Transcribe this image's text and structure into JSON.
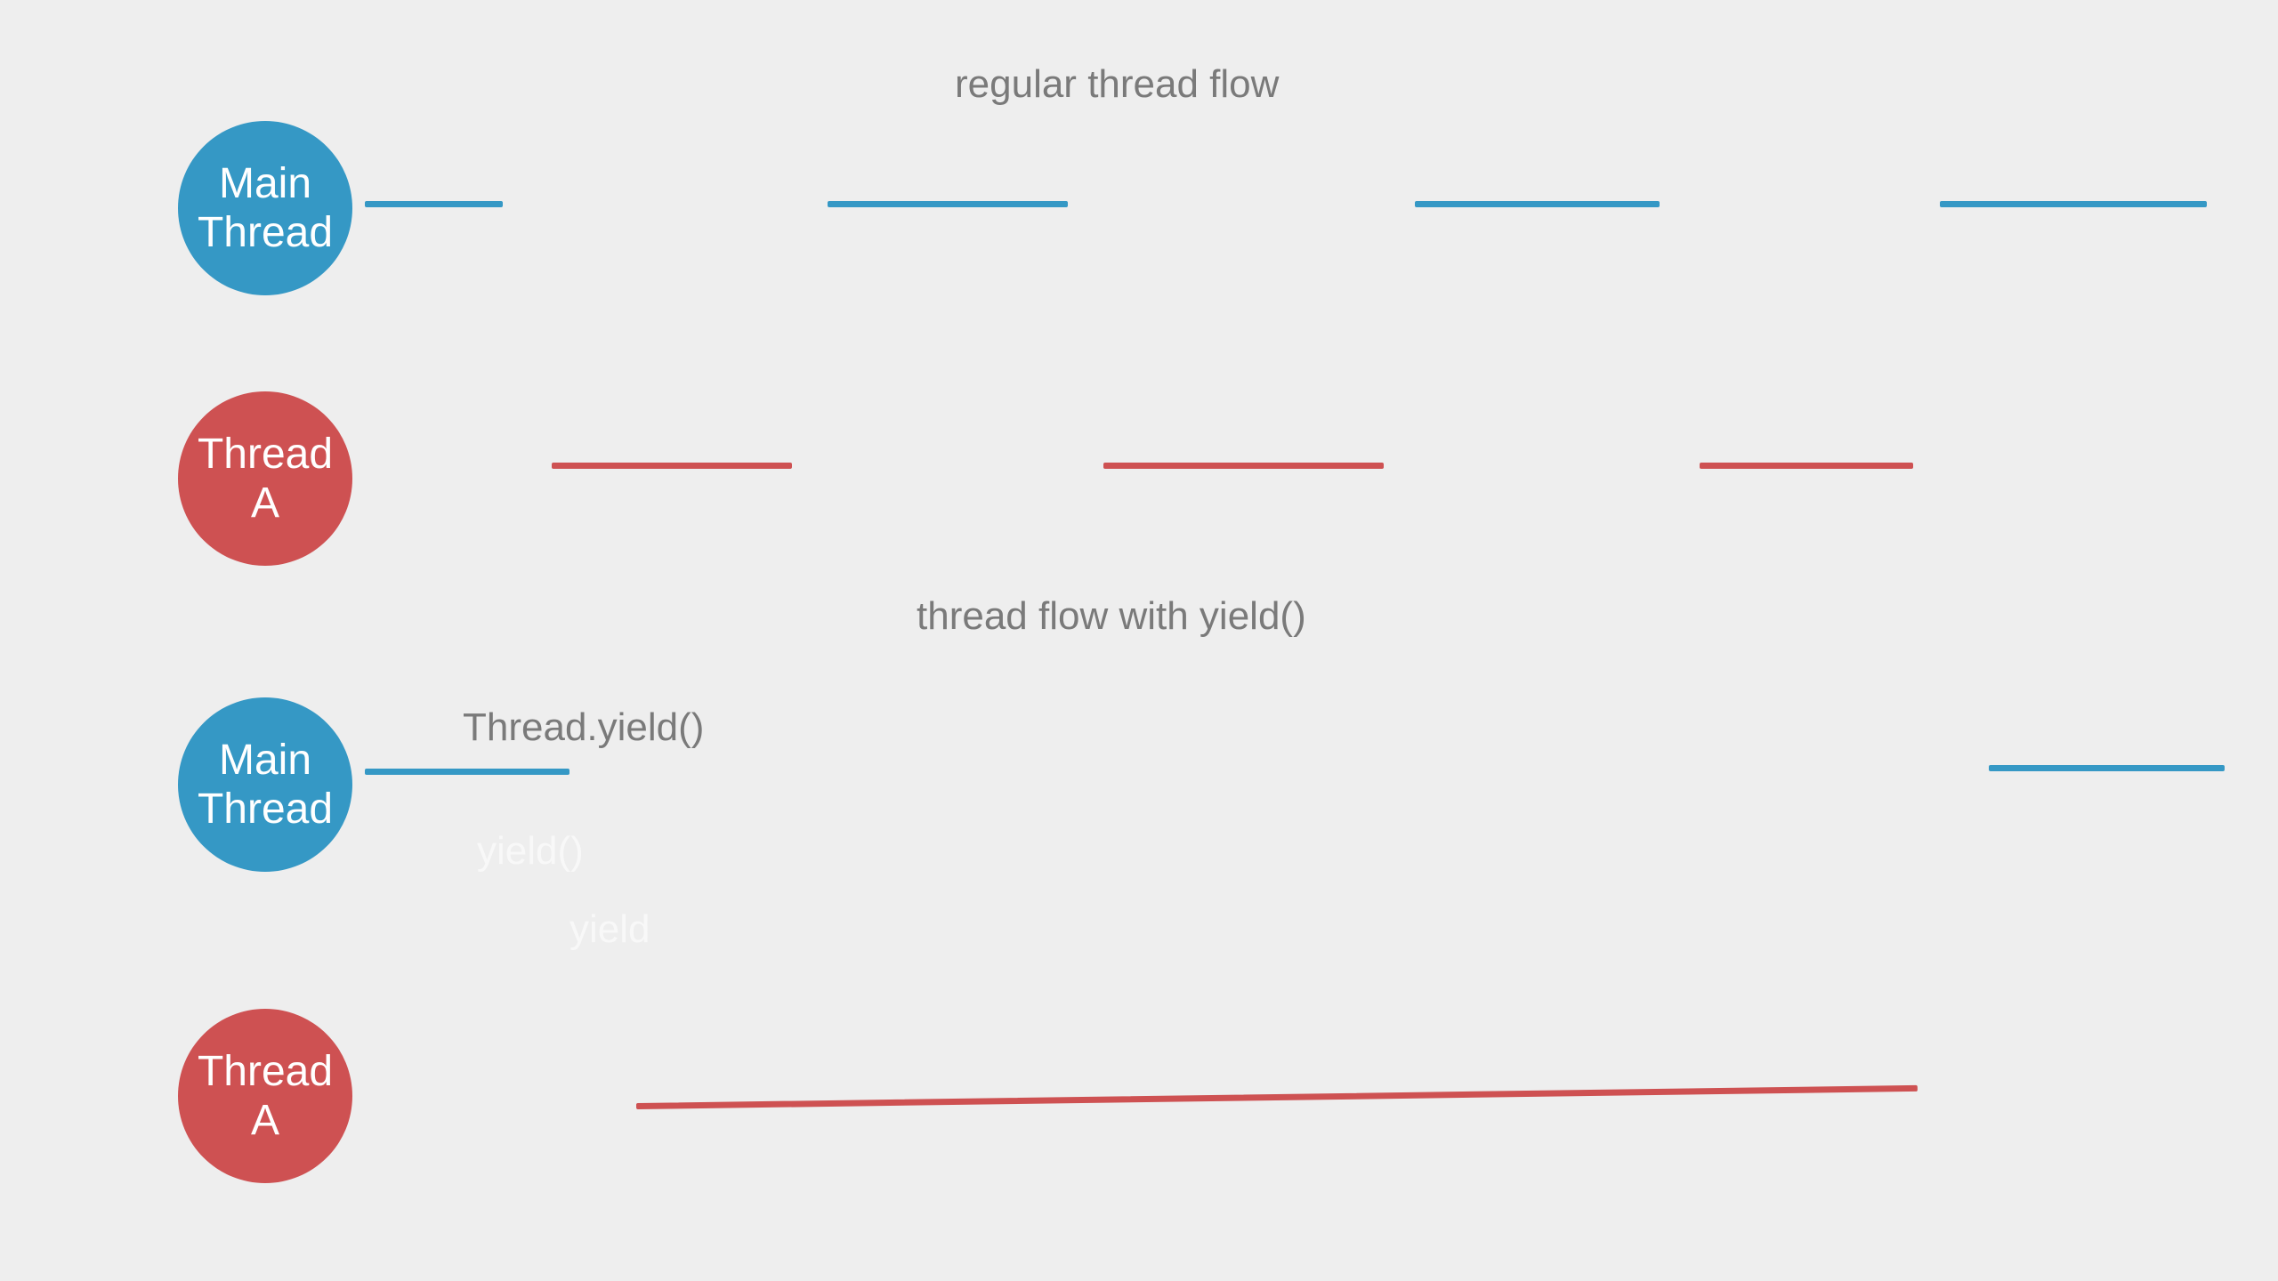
{
  "titles": {
    "regular": "regular thread flow",
    "yield": "thread flow with yield()"
  },
  "labels": {
    "main": "Main",
    "thread": "Thread",
    "threadA_l1": "Thread",
    "threadA_l2": "A",
    "yield_call": "Thread.yield()"
  },
  "colors": {
    "blue": "#3598c5",
    "red": "#ce5152",
    "text": "#7a7a7a",
    "bg": "#eeeeee"
  },
  "chart_data": {
    "type": "table",
    "title": "Thread scheduling comparison: regular vs yield()",
    "series": [
      {
        "name": "regular - Main Thread",
        "color": "#3598c5",
        "segments": [
          [
            410,
            565
          ],
          [
            930,
            1200
          ],
          [
            1590,
            1865
          ],
          [
            2180,
            2480
          ]
        ]
      },
      {
        "name": "regular - Thread A",
        "color": "#ce5152",
        "segments": [
          [
            620,
            890
          ],
          [
            1240,
            1555
          ],
          [
            1910,
            2150
          ]
        ]
      },
      {
        "name": "yield - Main Thread",
        "color": "#3598c5",
        "segments": [
          [
            410,
            640
          ],
          [
            2235,
            2500
          ]
        ]
      },
      {
        "name": "yield - Thread A",
        "color": "#ce5152",
        "segments": [
          [
            715,
            2155
          ]
        ]
      }
    ],
    "annotations": [
      {
        "text": "Thread.yield()",
        "x": 640,
        "series": "yield - Main Thread"
      }
    ]
  }
}
